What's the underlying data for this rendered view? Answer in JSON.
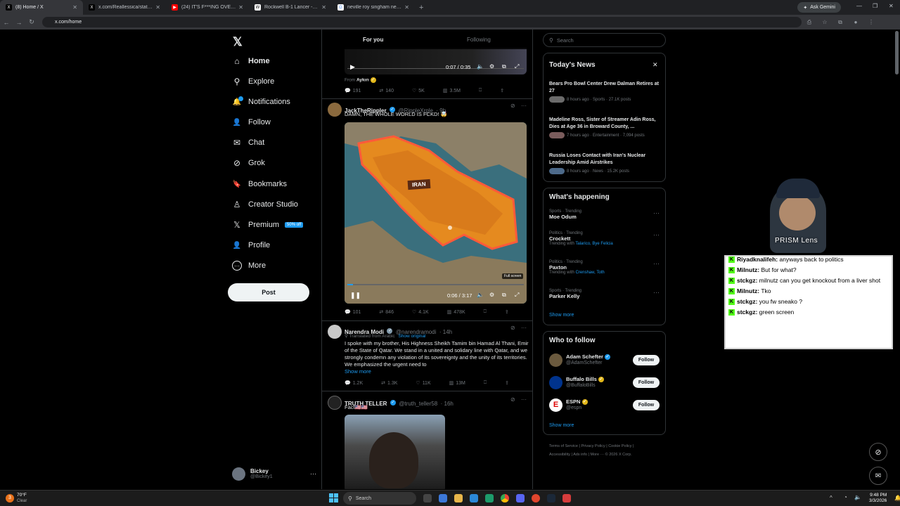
{
  "browser": {
    "tabs": [
      {
        "title": "(8) Home / X",
        "icon": "x-icon",
        "active": true
      },
      {
        "title": "x.com/Reallessica/status/2028…",
        "icon": "x-icon",
        "active": false
      },
      {
        "title": "(24) IT'S F***ING OVER. - YouTu…",
        "icon": "youtube-icon",
        "active": false
      },
      {
        "title": "Rockwell B-1 Lancer - Wikipedi…",
        "icon": "wikipedia-icon",
        "active": false
      },
      {
        "title": "neville roy singham net worth - …",
        "icon": "google-icon",
        "active": false
      }
    ],
    "new_tab": "+",
    "gemini_label": "Ask Gemini",
    "url": "x.com/home"
  },
  "sidebar": {
    "logo": "𝕏",
    "items": [
      {
        "label": "Home",
        "icon": "home-icon",
        "glyph": "⌂"
      },
      {
        "label": "Explore",
        "icon": "search-icon",
        "glyph": "⚲"
      },
      {
        "label": "Notifications",
        "icon": "bell-icon",
        "glyph": "🔔"
      },
      {
        "label": "Follow",
        "icon": "follow-icon",
        "glyph": "👤"
      },
      {
        "label": "Chat",
        "icon": "mail-icon",
        "glyph": "✉"
      },
      {
        "label": "Grok",
        "icon": "grok-icon",
        "glyph": "⊘"
      },
      {
        "label": "Bookmarks",
        "icon": "bookmark-icon",
        "glyph": "🔖"
      },
      {
        "label": "Creator Studio",
        "icon": "creator-icon",
        "glyph": "♙"
      },
      {
        "label": "Premium",
        "icon": "x-premium-icon",
        "glyph": "𝕏",
        "badge": "50% off"
      },
      {
        "label": "Profile",
        "icon": "profile-icon",
        "glyph": "👤"
      },
      {
        "label": "More",
        "icon": "more-icon",
        "glyph": "⋯"
      }
    ],
    "notif_count": "8",
    "post_label": "Post",
    "account": {
      "name": "Bickey",
      "handle": "@Bickey1"
    }
  },
  "feed": {
    "tabs": [
      "For you",
      "Following"
    ],
    "video1": {
      "time": "0:07 / 0:35",
      "from_label": "From",
      "from_name": "Aykırı"
    },
    "tweet0_metrics": {
      "replies": "191",
      "reposts": "140",
      "likes": "5K",
      "views": "3.5M"
    },
    "tweet1": {
      "name": "JackTheRippler",
      "handle": "@RippleXrple",
      "time": "· 9h",
      "text": "DAMN, THE WHOLE WORLD IS FCKD! 🤯",
      "map_label": "IRAN",
      "video_time": "0:06 / 3:17",
      "fullscreen_label": "Full screen",
      "metrics": {
        "replies": "101",
        "reposts": "846",
        "likes": "4.1K",
        "views": "478K"
      }
    },
    "tweet2": {
      "name": "Narendra Modi",
      "handle": "@narendramodi",
      "time": "· 14h",
      "translated": "Translated from Arabic",
      "show_original": "Show original",
      "text": "I spoke with my brother, His Highness Sheikh Tamim bin Hamad Al Thani, Emir of the State of Qatar. We stand in a united and solidary line with Qatar, and we strongly condemn any violation of its sovereignty and the unity of its territories. We emphasized the urgent need to",
      "show_more": "Show more",
      "metrics": {
        "replies": "1.2K",
        "reposts": "1.3K",
        "likes": "11K",
        "views": "13M"
      }
    },
    "tweet3": {
      "name": "TRUTH TELLER",
      "handle": "@truth_teller58",
      "time": "· 16h",
      "text": "Fact🇺🇸🇺🇸"
    }
  },
  "right": {
    "search_placeholder": "Search",
    "news": {
      "title": "Today's News",
      "items": [
        {
          "title": "Bears Pro Bowl Center Drew Dalman Retires at 27",
          "meta": "8 hours ago · Sports · 27.1K posts"
        },
        {
          "title": "Madeline Ross, Sister of Streamer Adin Ross, Dies at Age 36 in Broward County, ...",
          "meta": "7 hours ago · Entertainment · 7,094 posts"
        },
        {
          "title": "Russia Loses Contact with Iran's Nuclear Leadership Amid Airstrikes",
          "meta": "8 hours ago · News · 15.2K posts"
        }
      ]
    },
    "happening": {
      "title": "What's happening",
      "items": [
        {
          "cat": "Sports · Trending",
          "name": "Moe Odum",
          "with_label": "",
          "with": ""
        },
        {
          "cat": "Politics · Trending",
          "name": "Crockett",
          "with_label": "Trending with",
          "with": "Talarico, Bye Felicia"
        },
        {
          "cat": "Politics · Trending",
          "name": "Paxton",
          "with_label": "Trending with",
          "with": "Crenshaw, Toth"
        },
        {
          "cat": "Sports · Trending",
          "name": "Parker Kelly",
          "with_label": "",
          "with": ""
        }
      ],
      "show_more": "Show more"
    },
    "who": {
      "title": "Who to follow",
      "items": [
        {
          "name": "Adam Schefter",
          "handle": "@AdamSchefter",
          "btn": "Follow"
        },
        {
          "name": "Buffalo Bills",
          "handle": "@BuffaloBills",
          "btn": "Follow"
        },
        {
          "name": "ESPN",
          "handle": "@espn",
          "btn": "Follow"
        }
      ],
      "show_more": "Show more"
    },
    "footer": {
      "line1": [
        "Terms of Service",
        "Privacy Policy",
        "Cookie Policy"
      ],
      "line2": [
        "Accessibility",
        "Ads info",
        "More ···",
        "© 2026 X Corp."
      ]
    }
  },
  "stream": {
    "cam_label": "PRISM Lens",
    "chat": [
      {
        "user": "Riyadknalifeh:",
        "msg": "anyways back to politics"
      },
      {
        "user": "Milnutz:",
        "msg": "But for what?"
      },
      {
        "user": "stckgz:",
        "msg": "milnutz can you get knockout from a liver shot"
      },
      {
        "user": "Milnutz:",
        "msg": "Tko"
      },
      {
        "user": "stckgz:",
        "msg": "you fw sneako ?"
      },
      {
        "user": "stckgz:",
        "msg": "green screen"
      }
    ]
  },
  "taskbar": {
    "weather_temp": "70°F",
    "weather_desc": "Clear",
    "weather_badge": "3",
    "search_label": "Search",
    "time": "9:48 PM",
    "date": "3/3/2026"
  }
}
